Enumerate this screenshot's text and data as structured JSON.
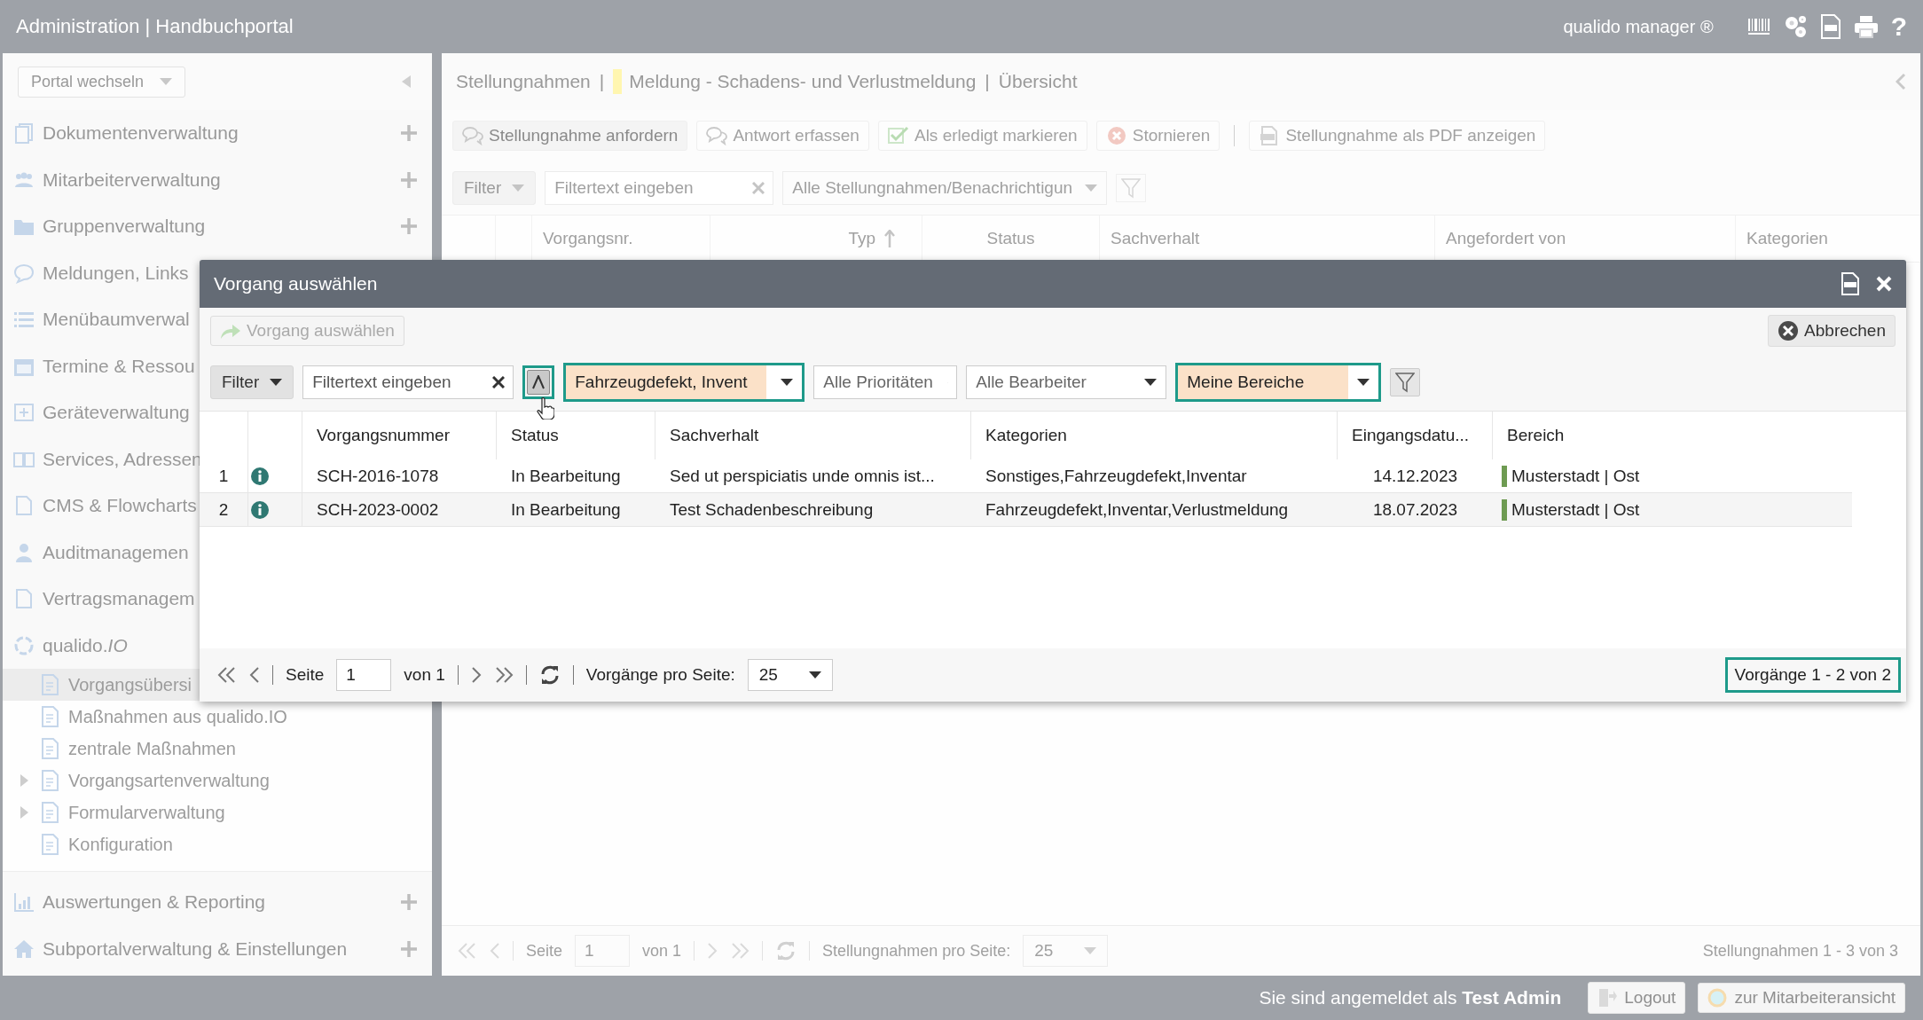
{
  "topbar": {
    "title": "Administration | Handbuchportal",
    "brand": "qualido manager ®",
    "help": "?"
  },
  "sidebar": {
    "portal_select": "Portal wechseln",
    "modules": [
      {
        "label": "Dokumentenverwaltung",
        "add": true
      },
      {
        "label": "Mitarbeiterverwaltung",
        "add": true
      },
      {
        "label": "Gruppenverwaltung",
        "add": true
      },
      {
        "label": "Meldungen, Links",
        "add": false
      },
      {
        "label": "Menübaumverwal",
        "add": false
      },
      {
        "label": "Termine & Ressou",
        "add": false
      },
      {
        "label": "Geräteverwaltung",
        "add": false
      },
      {
        "label": "Services, Adressen",
        "add": false
      },
      {
        "label": "CMS & Flowcharts",
        "add": false
      },
      {
        "label": "Auditmanagemen",
        "add": false
      },
      {
        "label": "Vertragsmanagem",
        "add": false
      },
      {
        "label": "qualido.*IO*",
        "add": false,
        "children": [
          {
            "label": "Vorgangsübersi",
            "selected": true
          },
          {
            "label": "Maßnahmen aus qualido.IO",
            "selected": false
          },
          {
            "label": "zentrale Maßnahmen",
            "selected": false
          },
          {
            "label": "Vorgangsartenverwaltung",
            "selected": false,
            "expanded": false
          },
          {
            "label": "Formularverwaltung",
            "selected": false,
            "expanded": false
          },
          {
            "label": "Konfiguration",
            "selected": false
          }
        ]
      }
    ],
    "bottom_modules": [
      {
        "label": "Auswertungen & Reporting",
        "add": true
      },
      {
        "label": "Subportalverwaltung & Einstellungen",
        "add": true
      }
    ]
  },
  "main": {
    "breadcrumb": [
      "Stellungnahmen",
      "|",
      "Meldung - Schadens- und Verlustmeldung",
      "|",
      "Übersicht"
    ],
    "toolbar": [
      {
        "label": "Stellungnahme anfordern",
        "disabled": false,
        "separator_before": false
      },
      {
        "label": "Antwort erfassen",
        "disabled": true,
        "separator_before": false
      },
      {
        "label": "Als erledigt markieren",
        "disabled": true,
        "separator_before": false
      },
      {
        "label": "Stornieren",
        "disabled": true,
        "separator_before": false
      },
      {
        "label": "Stellungnahme als PDF anzeigen",
        "disabled": true,
        "separator_before": true
      }
    ],
    "filter": {
      "button": "Filter",
      "placeholder": "Filtertext eingeben",
      "select": "Alle Stellungnahmen/Benachrichtigun"
    },
    "columns": [
      {
        "label": "Vorgangsnr.",
        "sorted": false
      },
      {
        "label": "Typ",
        "sorted": true
      },
      {
        "label": "Status",
        "sorted": false
      },
      {
        "label": "Sachverhalt",
        "sorted": false
      },
      {
        "label": "Angefordert von",
        "sorted": false
      },
      {
        "label": "Kategorien",
        "sorted": false
      }
    ],
    "pager": {
      "page_label": "Seite",
      "page": "1",
      "of": "von 1",
      "per_page_label": "Stellungnahmen pro Seite:",
      "per_page": "25",
      "summary": "Stellungnahmen 1 - 3 von 3",
      "summary_highlighted": false
    }
  },
  "dialog": {
    "title": "Vorgang auswählen",
    "select_button": {
      "label": "Vorgang auswählen",
      "disabled": true
    },
    "cancel": "Abbrechen",
    "filter": {
      "button": "Filter",
      "placeholder": "Filtertext eingeben",
      "advanced_open": true,
      "selects": [
        {
          "value": "Fahrzeugdefekt, Invent",
          "active": true
        },
        {
          "value": "Alle Prioritäten",
          "active": false
        },
        {
          "value": "Alle Bearbeiter",
          "active": false
        },
        {
          "value": "Meine Bereiche",
          "active": true
        }
      ]
    },
    "columns": [
      "Vorgangsnummer",
      "Status",
      "Sachverhalt",
      "Kategorien",
      "Eingangsdatu...",
      "Bereich"
    ],
    "rows": [
      {
        "index": "1",
        "number": "SCH-2016-1078",
        "status": "In Bearbeitung",
        "facts": "Sed ut perspiciatis unde omnis ist...",
        "categories": "Sonstiges,Fahrzeugdefekt,Inventar",
        "date": "14.12.2023",
        "area": "Musterstadt | Ost",
        "color": "#6e9b52"
      },
      {
        "index": "2",
        "number": "SCH-2023-0002",
        "status": "In Bearbeitung",
        "facts": "Test Schadenbeschreibung",
        "categories": "Fahrzeugdefekt,Inventar,Verlustmeldung",
        "date": "18.07.2023",
        "area": "Musterstadt | Ost",
        "color": "#6e9b52"
      }
    ],
    "pager": {
      "page_label": "Seite",
      "page": "1",
      "of": "von 1",
      "per_page_label": "Vorgänge pro Seite:",
      "per_page": "25",
      "summary": "Vorgänge 1 - 2 von 2",
      "summary_highlighted": true
    }
  },
  "footer": {
    "login_text": "Sie sind angemeldet als **Test Admin**",
    "logout": "Logout",
    "switch_view": "zur Mitarbeiteransicht"
  }
}
